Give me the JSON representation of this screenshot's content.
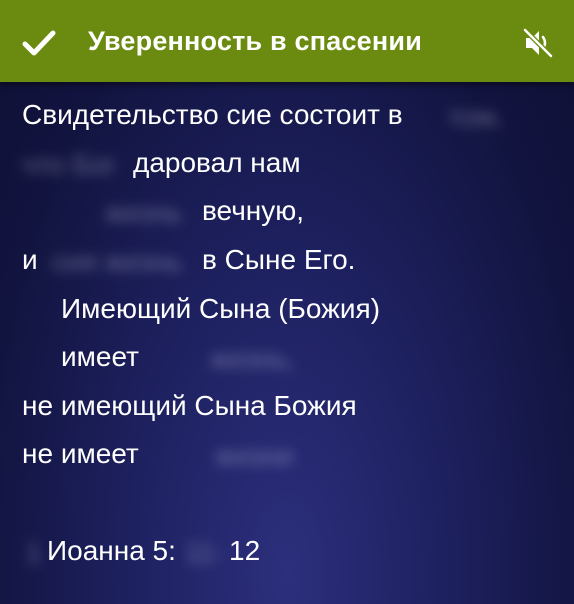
{
  "header": {
    "title": "Уверенность в спасении",
    "check_icon": "check-icon",
    "mute_icon": "volume-mute-icon",
    "bar_color": "#6b8a10"
  },
  "verse": {
    "line1": "Свидетельство сие состоит в",
    "line2": "даровал нам",
    "line3": "вечную,",
    "line4a": "и",
    "line4b": "в Сыне Его.",
    "line5": "Имеющий Сына (Божия)",
    "line6": "имеет",
    "line7": "не имеющий  Сына Божия",
    "line8": "не имеет",
    "ref_book": "Иоанна 5:",
    "ref_verse_end": "12"
  },
  "hidden": {
    "w1": "том,",
    "w2": "что Бог",
    "w3": "жизнь",
    "w4": "сия жизнь",
    "w5": "жизнь,",
    "w6": "жизни",
    "w7": "1",
    "w8": "11-"
  }
}
